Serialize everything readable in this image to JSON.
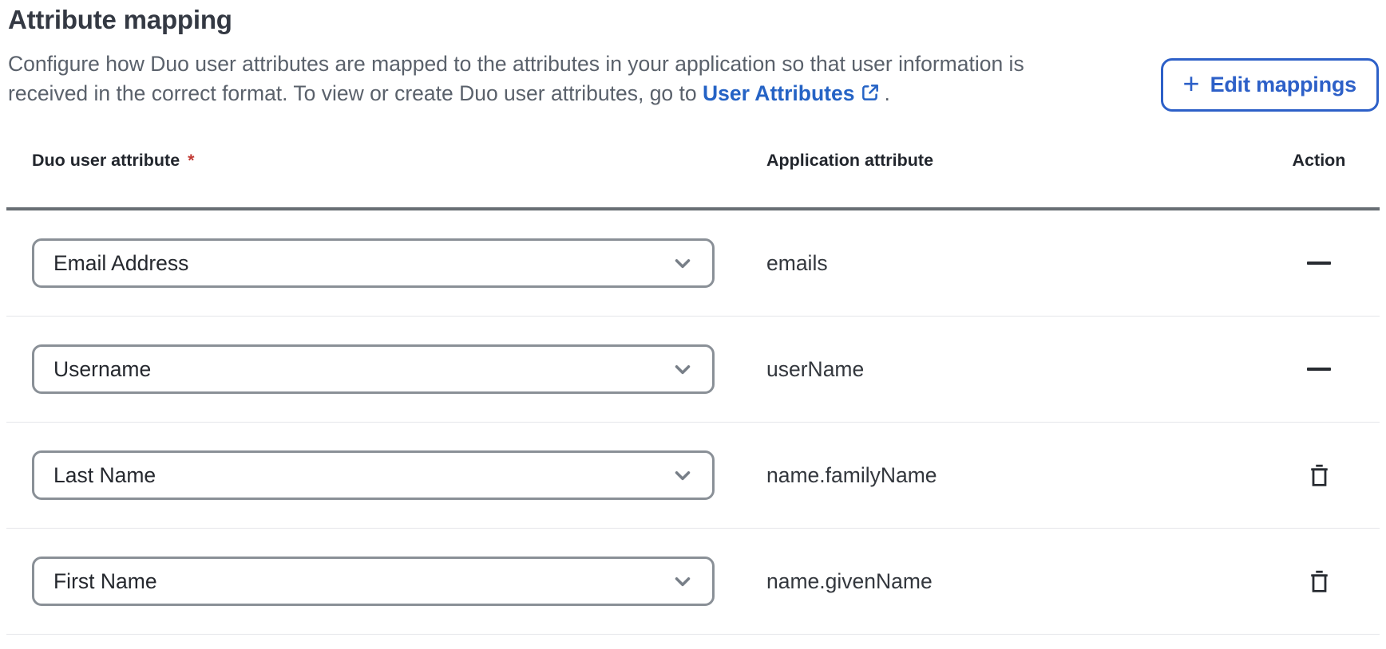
{
  "page": {
    "title": "Attribute mapping",
    "description": {
      "line1": "Configure how Duo user attributes are mapped to the attributes in your application so that user information is",
      "line2_prefix": "received in the correct format. To view or create Duo user attributes, go to ",
      "link_text": "User Attributes",
      "suffix": "."
    },
    "edit_button": {
      "plus": "+",
      "label": "Edit mappings"
    },
    "colors": {
      "accent_blue": "#2d60c8",
      "link_blue": "#2563c5",
      "required_red": "#c23a34",
      "header_rule_gray": "#686e74",
      "row_divider_gray": "#e5e6ea"
    },
    "icons": {
      "plus": "plus-icon",
      "external_link": "external-link-icon",
      "chevron_down": "chevron-down-icon",
      "trash": "trash-icon",
      "no_action": "dash"
    }
  },
  "table": {
    "headers": {
      "duo": "Duo user attribute",
      "required_marker": "*",
      "application": "Application attribute",
      "action": "Action"
    },
    "rows": [
      {
        "duo_attribute": "Email Address",
        "application_attribute": "emails",
        "action": "none"
      },
      {
        "duo_attribute": "Username",
        "application_attribute": "userName",
        "action": "none"
      },
      {
        "duo_attribute": "Last Name",
        "application_attribute": "name.familyName",
        "action": "delete"
      },
      {
        "duo_attribute": "First Name",
        "application_attribute": "name.givenName",
        "action": "delete"
      }
    ]
  }
}
